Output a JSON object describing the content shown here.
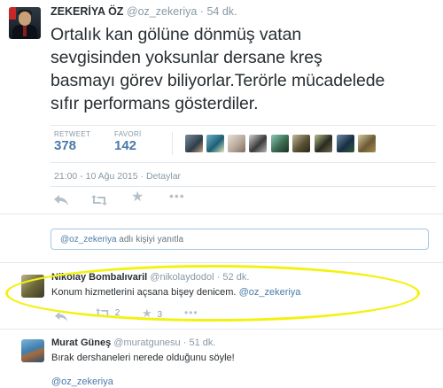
{
  "tweet": {
    "name": "ZEKERİYA ÖZ",
    "handle": "@oz_zekeriya",
    "time": "54 dk.",
    "text_lines": [
      "Ortalık kan gölüne dönmüş vatan",
      "sevgisinden yoksunlar dersane kreş",
      "basmayı görev biliyorlar.Terörle mücadelede",
      "sıfır performans gösterdiler."
    ],
    "retweets_label": "RETWEET",
    "retweets_value": "378",
    "favorites_label": "FAVORİ",
    "favorites_value": "142",
    "timestamp": "21:00 - 10 Ağu 2015",
    "details_sep": "·",
    "details_link": "Detaylar"
  },
  "reply_box": {
    "mention": "@oz_zekeriya",
    "text": "adlı kişiyi yanıtla"
  },
  "replies": [
    {
      "name": "Nikolay Bombalıvaril",
      "handle": "@nikolaydodol",
      "time": "52 dk.",
      "text": "Konum hizmetlerini açsana bişey denicem.",
      "mention": "@oz_zekeriya",
      "retweet_count": "2",
      "favorite_count": "3"
    },
    {
      "name": "Murat Güneş",
      "handle": "@muratgunesu",
      "time": "51 dk.",
      "text": "Bırak dershaneleri nerede olduğunu söyle!",
      "mention": "@oz_zekeriya"
    }
  ],
  "colors": {
    "link": "#4a7aa8",
    "muted": "#8899a6",
    "highlight": "#f4f10f"
  },
  "icons": {
    "reply": "reply-icon",
    "retweet": "retweet-icon",
    "favorite": "star-icon",
    "more": "more-icon"
  }
}
